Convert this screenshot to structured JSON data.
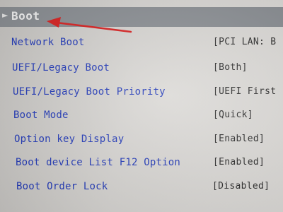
{
  "header": {
    "active_tab": "Boot"
  },
  "settings": [
    {
      "label": "Network Boot",
      "value": "[PCI LAN: B"
    },
    {
      "label": "UEFI/Legacy Boot",
      "value": "[Both]"
    },
    {
      "label": "UEFI/Legacy Boot Priority",
      "value": "[UEFI First"
    },
    {
      "label": "Boot Mode",
      "value": "[Quick]"
    },
    {
      "label": "Option key Display",
      "value": "[Enabled]"
    },
    {
      "label": "Boot device List F12 Option",
      "value": "[Enabled]"
    },
    {
      "label": "Boot Order Lock",
      "value": "[Disabled]"
    }
  ],
  "colors": {
    "label": "#1f37b8",
    "value": "#2a2a2a",
    "top_bar": "#8a8e93",
    "annotation_arrow": "#d81e1e"
  }
}
